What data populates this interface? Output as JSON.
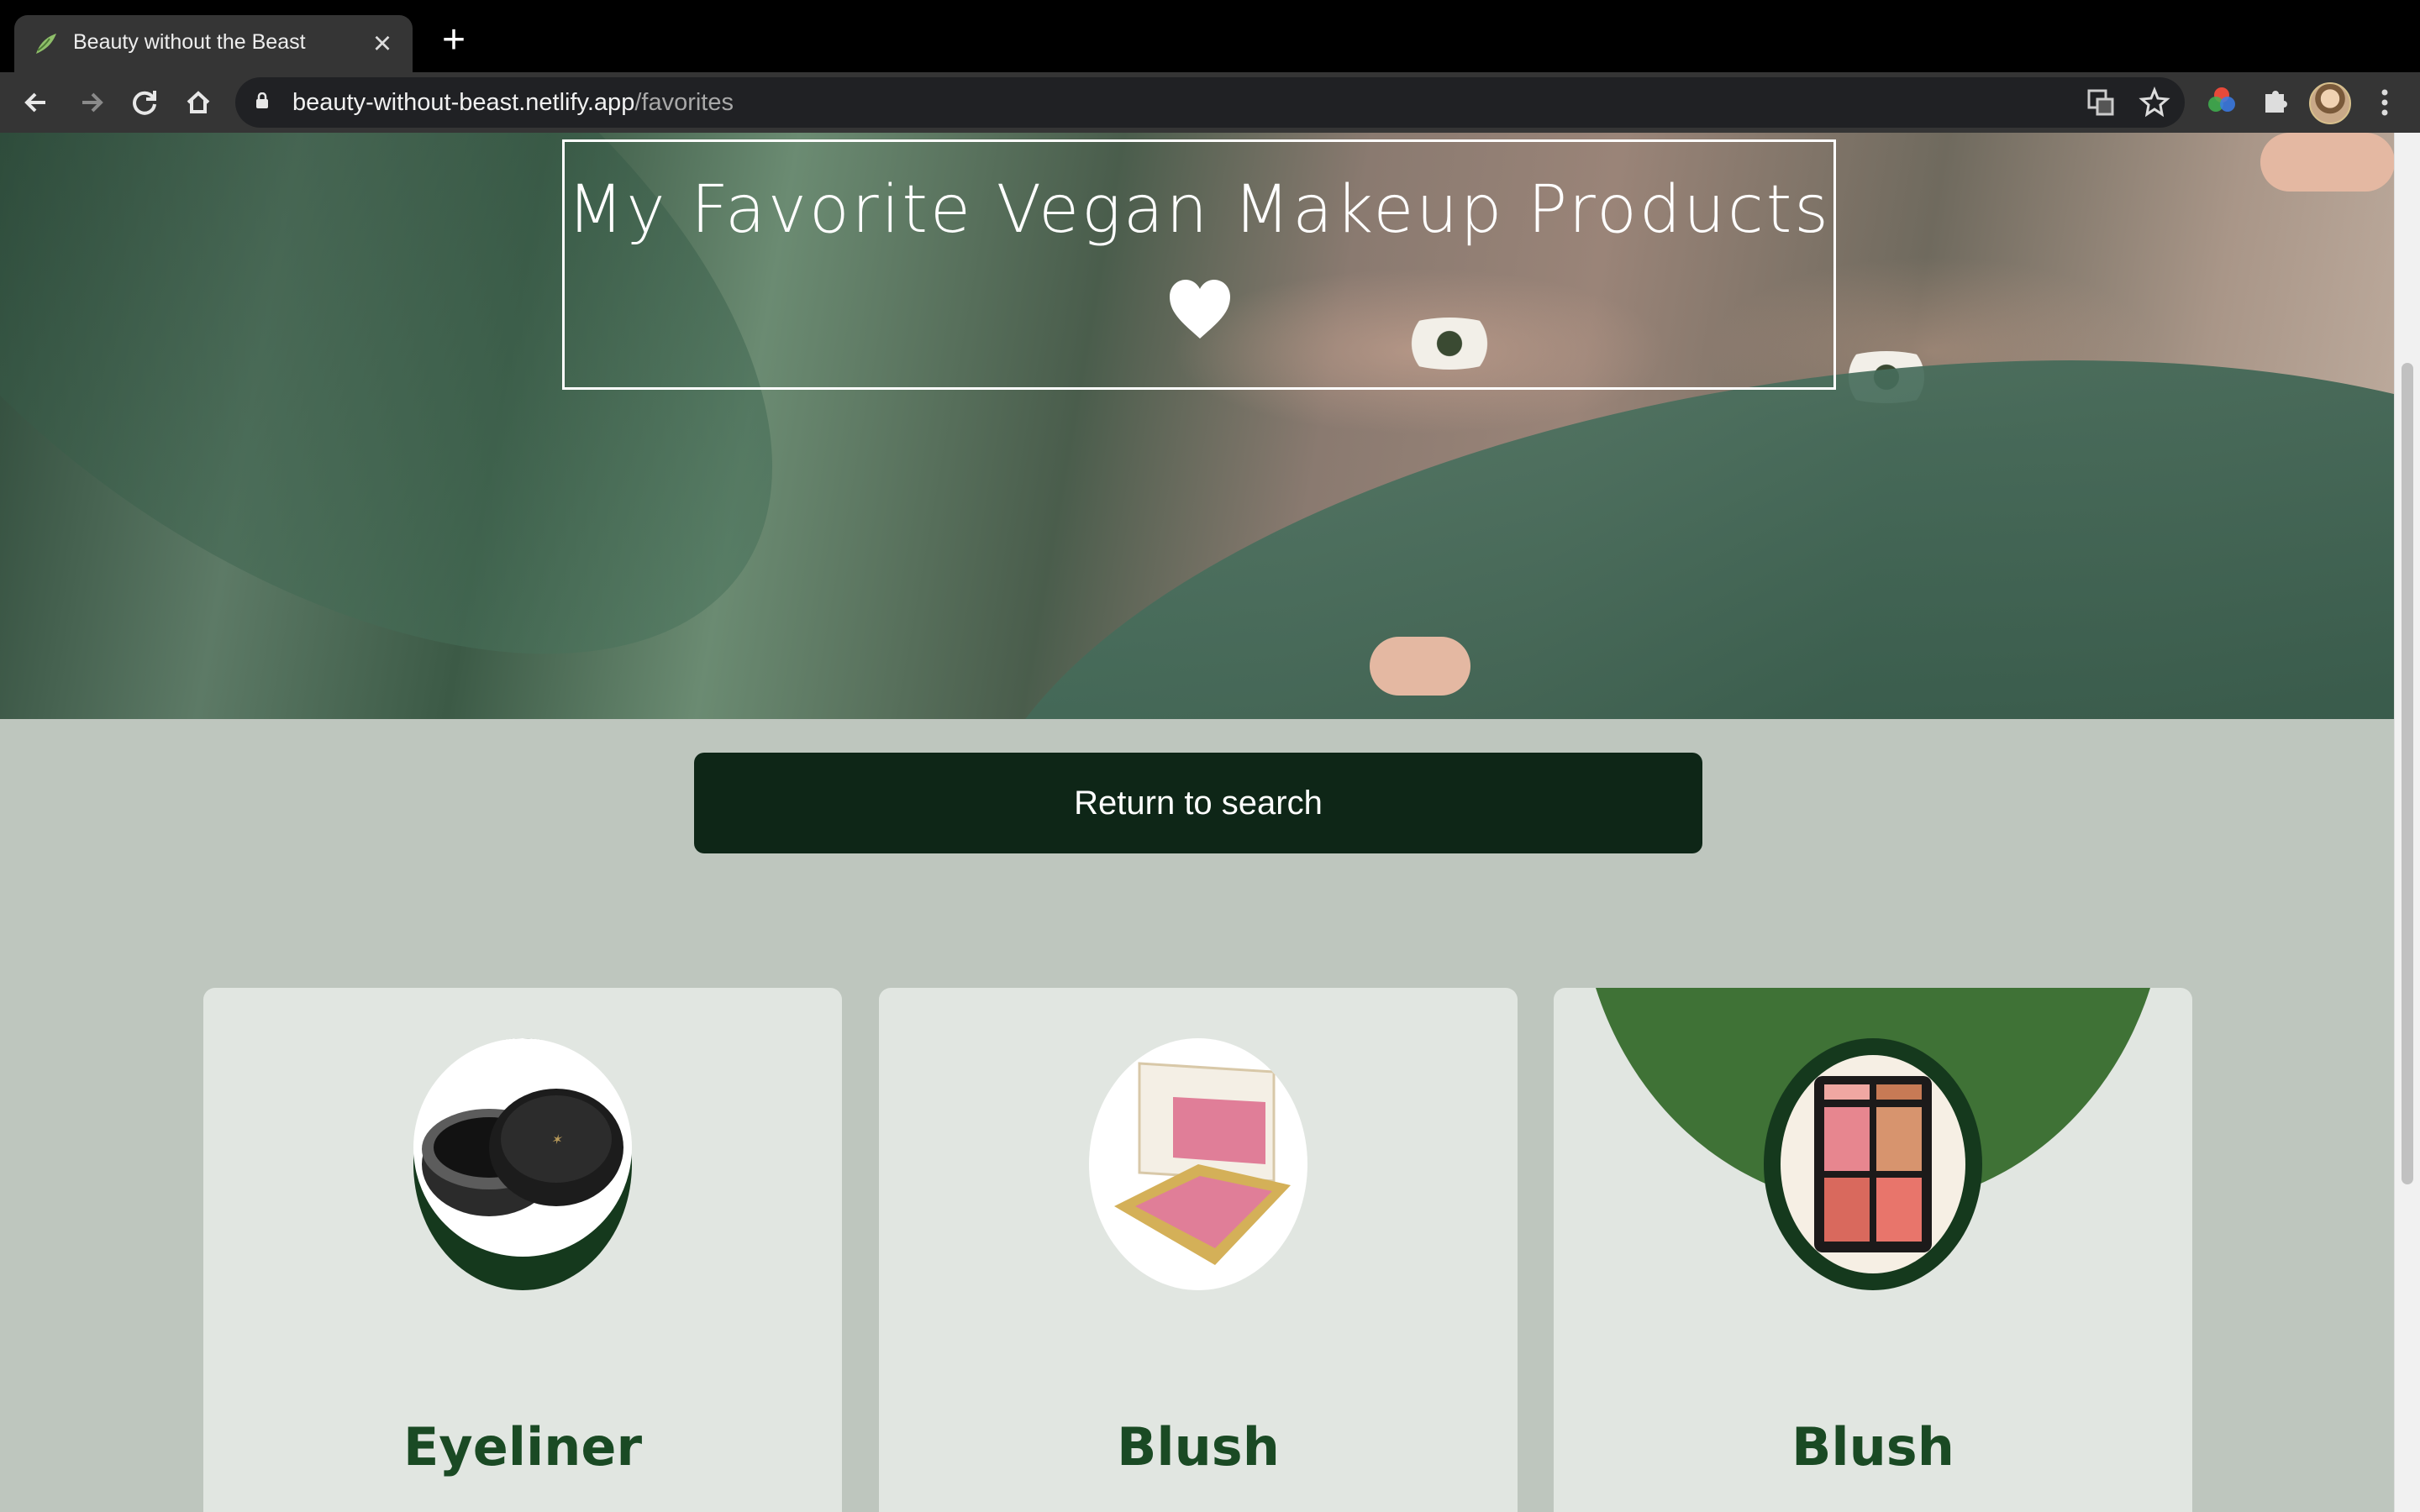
{
  "browser": {
    "tab_title": "Beauty without the Beast",
    "close_glyph": "×",
    "newtab_glyph": "+",
    "url_host": "beauty-without-beast.netlify.app",
    "url_path": "/favorites",
    "icons": [
      "back-icon",
      "forward-icon",
      "reload-icon",
      "home-icon",
      "lock-icon",
      "translate-icon",
      "bookmark-star-icon",
      "color-extension-icon",
      "extensions-puzzle-icon",
      "profile-avatar",
      "menu-kebab-icon"
    ]
  },
  "page": {
    "title": "My Favorite Vegan Makeup Products",
    "return_button": "Return to search",
    "cards": [
      {
        "title": "Eyeliner",
        "image": "eyeliner-pot-image"
      },
      {
        "title": "Blush",
        "image": "blush-compact-image"
      },
      {
        "title": "Blush",
        "image": "blush-palette-image"
      }
    ]
  },
  "colors": {
    "page_bg": "#bec6be",
    "card_bg": "#e1e6e1",
    "button_bg": "#0e2617",
    "card_title": "#1a4a24",
    "accent_green": "#3f7236",
    "dark_green": "#15391d"
  }
}
